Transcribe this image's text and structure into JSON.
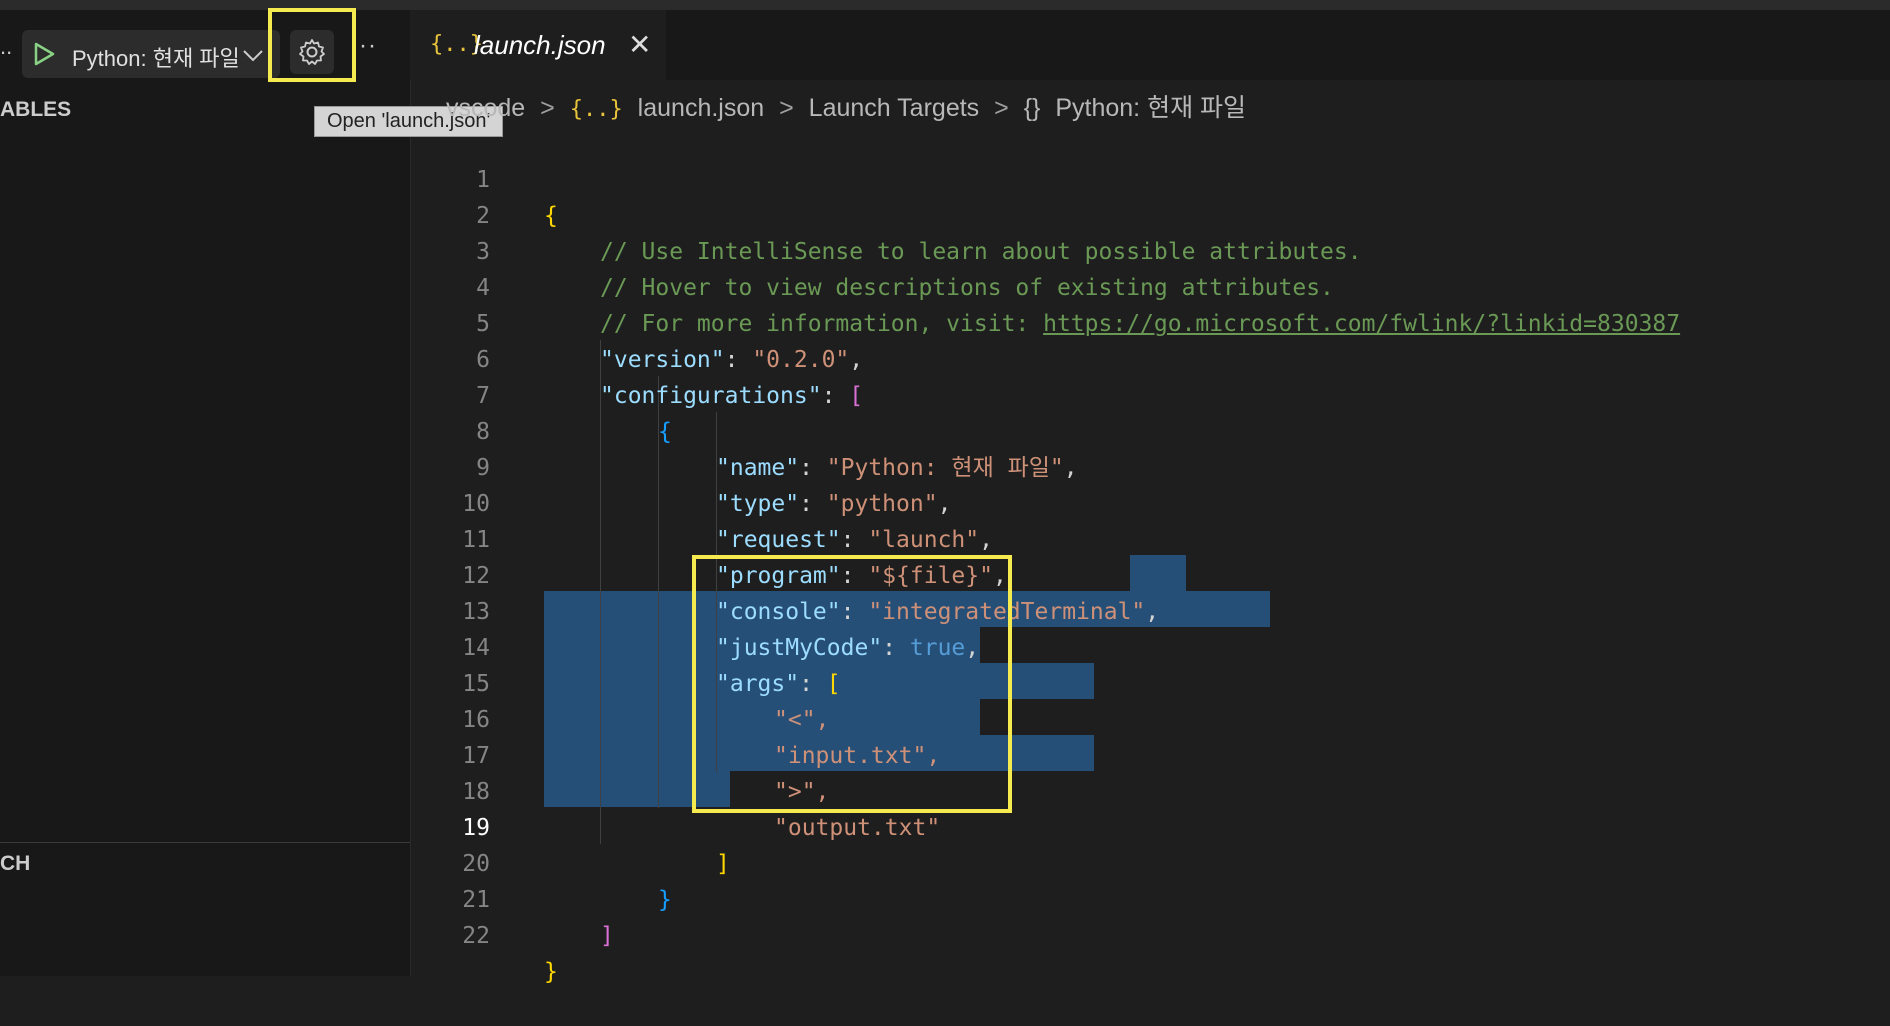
{
  "debug": {
    "left_ellipsis": "..",
    "config_name": "Python: 현재 파일",
    "more": "···",
    "tooltip": "Open 'launch.json'"
  },
  "sidebar": {
    "variables_title": "ABLES",
    "watch_title": "CH"
  },
  "tab": {
    "icon": "{..}",
    "title": "launch.json",
    "close": "✕"
  },
  "breadcrumb": {
    "folder": "vscode",
    "sep": ">",
    "file_icon": "{..}",
    "file": "launch.json",
    "section": "Launch Targets",
    "item_icon": "{}",
    "item": "Python: 현재 파일"
  },
  "code_lines": [
    {
      "n": "1",
      "t": "{"
    },
    {
      "n": "2",
      "t": "// Use IntelliSense to learn about possible attributes."
    },
    {
      "n": "3",
      "t": "// Hover to view descriptions of existing attributes."
    },
    {
      "n": "4",
      "t": "// For more information, visit: ",
      "url": "https://go.microsoft.com/fwlink/?linkid=830387"
    },
    {
      "n": "5",
      "key": "\"version\"",
      "val": "\"0.2.0\"",
      "tail": ","
    },
    {
      "n": "6",
      "key": "\"configurations\"",
      "open": "["
    },
    {
      "n": "7",
      "t": "{"
    },
    {
      "n": "8",
      "key": "\"name\"",
      "val": "\"Python: 현재 파일\"",
      "tail": ","
    },
    {
      "n": "9",
      "key": "\"type\"",
      "val": "\"python\"",
      "tail": ","
    },
    {
      "n": "10",
      "key": "\"request\"",
      "val": "\"launch\"",
      "tail": ","
    },
    {
      "n": "11",
      "key": "\"program\"",
      "val": "\"${file}\"",
      "tail": ","
    },
    {
      "n": "12",
      "key": "\"console\"",
      "val": "\"integratedTerminal\"",
      "tail": ","
    },
    {
      "n": "13",
      "key": "\"justMyCode\"",
      "val": "true",
      "tail": ","
    },
    {
      "n": "14",
      "key": "\"args\"",
      "open": "["
    },
    {
      "n": "15",
      "t": "\"<\","
    },
    {
      "n": "16",
      "t": "\"input.txt\","
    },
    {
      "n": "17",
      "t": "\">\","
    },
    {
      "n": "18",
      "t": "\"output.txt\""
    },
    {
      "n": "19",
      "t": "]"
    },
    {
      "n": "20",
      "t": "}"
    },
    {
      "n": "21",
      "t": "]"
    },
    {
      "n": "22",
      "t": "}"
    }
  ],
  "colors": {
    "highlight_box": "#f5eb4e",
    "selection": "#264f78"
  }
}
